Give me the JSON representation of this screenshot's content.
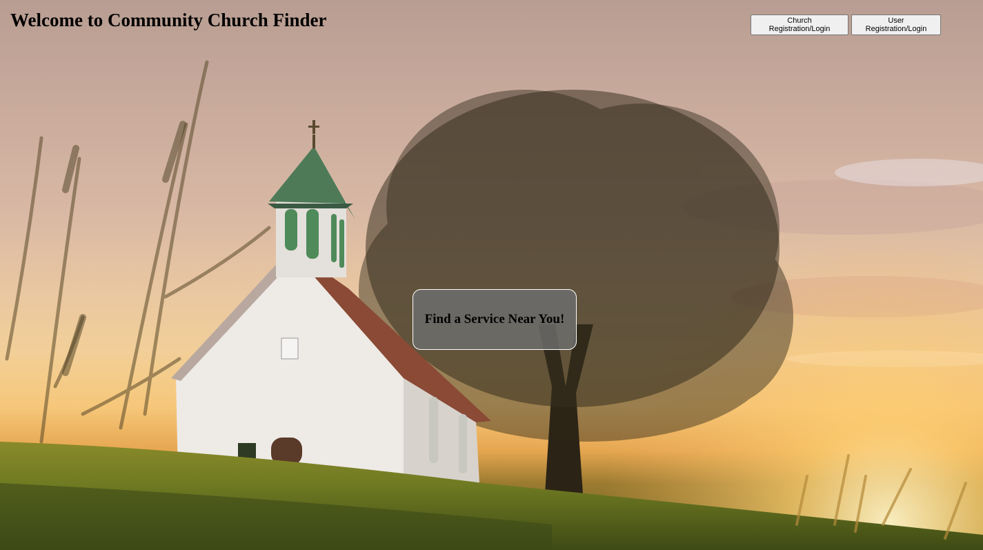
{
  "header": {
    "title": "Welcome to Community Church Finder"
  },
  "auth": {
    "church_label": "Church Registration/Login",
    "user_label": "User Registration/Login"
  },
  "hero": {
    "cta_label": "Find a Service Near You!"
  }
}
